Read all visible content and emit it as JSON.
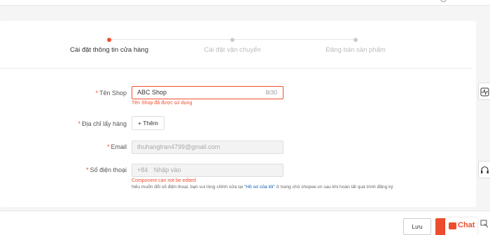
{
  "steps": [
    {
      "label": "Cài đặt thông tin cửa hàng",
      "active": true
    },
    {
      "label": "Cài đặt vận chuyển",
      "active": false
    },
    {
      "label": "Đăng bán sản phẩm",
      "active": false
    }
  ],
  "form": {
    "required_mark": "*",
    "shop_name": {
      "label": "Tên Shop",
      "value": "ABC Shop",
      "counter": "8/30",
      "error": "Tên Shop đã được sử dụng"
    },
    "address": {
      "label": "Địa chỉ lấy hàng",
      "add_button": "+ Thêm"
    },
    "email": {
      "label": "Email",
      "value": "thuhangtran4799@gmail.com"
    },
    "phone": {
      "label": "Số điện thoại",
      "prefix": "+84",
      "placeholder": "Nhập vào",
      "error": "Component can not be edited",
      "hint_before": "Nếu muốn đổi số điện thoại, bạn vui lòng chỉnh sửa tại ",
      "hint_link": "\"Hồ sơ của tôi\"",
      "hint_after": " ở trang chủ shopee.vn sau khi hoàn tất quá trình đăng ký"
    }
  },
  "footer": {
    "save_label": "Lưu"
  },
  "chat": {
    "label": "Chat"
  },
  "colors": {
    "accent": "#ee4d2d",
    "link": "#0055aa"
  },
  "icons": [
    "chevron-down-icon",
    "activity-icon",
    "headset-icon",
    "chat-icon",
    "window-icon"
  ]
}
